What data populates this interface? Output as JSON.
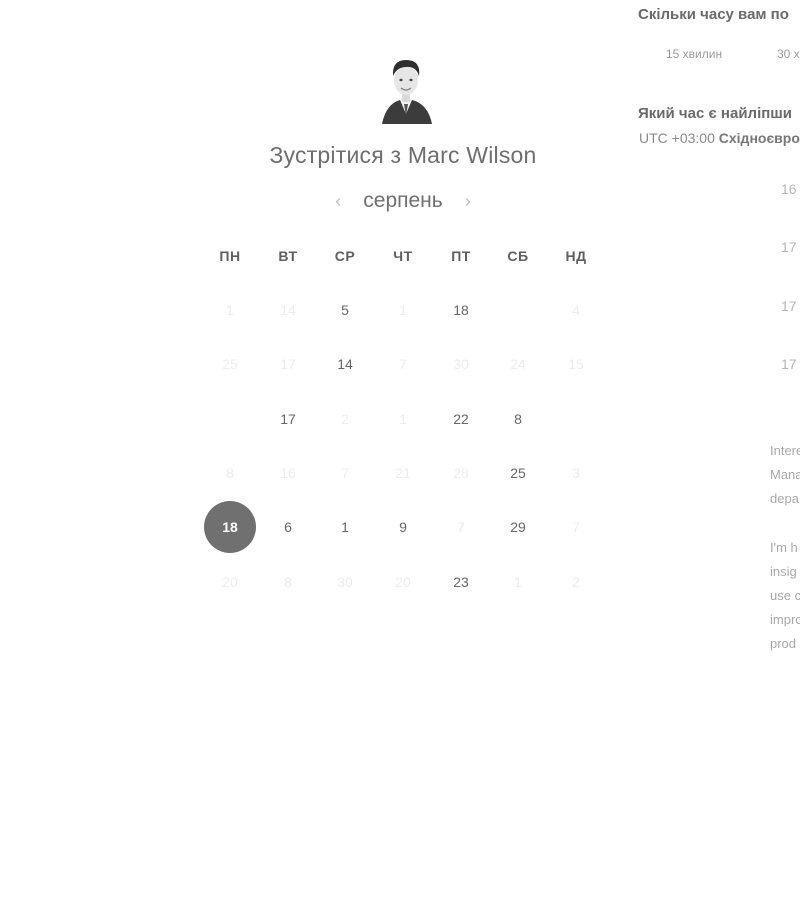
{
  "host": {
    "title_prefix": "Зустрітися з",
    "name": "Marc Wilson"
  },
  "calendar": {
    "month": "серпень",
    "weekdays": [
      "ПН",
      "ВТ",
      "СР",
      "ЧТ",
      "ПТ",
      "СБ",
      "НД"
    ],
    "rows": [
      [
        {
          "t": "1",
          "s": "dim"
        },
        {
          "t": "14",
          "s": "dim"
        },
        {
          "t": "5",
          "s": "avail"
        },
        {
          "t": "1",
          "s": "dim"
        },
        {
          "t": "18",
          "s": "avail"
        },
        {
          "t": "",
          "s": "dim"
        },
        {
          "t": "4",
          "s": "dim"
        }
      ],
      [
        {
          "t": "25",
          "s": "dim"
        },
        {
          "t": "17",
          "s": "dim"
        },
        {
          "t": "14",
          "s": "avail"
        },
        {
          "t": "7",
          "s": "dim"
        },
        {
          "t": "30",
          "s": "dim"
        },
        {
          "t": "24",
          "s": "dim"
        },
        {
          "t": "15",
          "s": "dim"
        }
      ],
      [
        {
          "t": "",
          "s": "dim"
        },
        {
          "t": "17",
          "s": "avail"
        },
        {
          "t": "2",
          "s": "dim"
        },
        {
          "t": "1",
          "s": "dim"
        },
        {
          "t": "22",
          "s": "avail"
        },
        {
          "t": "8",
          "s": "avail"
        },
        {
          "t": "",
          "s": "dim"
        }
      ],
      [
        {
          "t": "8",
          "s": "dim"
        },
        {
          "t": "16",
          "s": "dim"
        },
        {
          "t": "7",
          "s": "dim"
        },
        {
          "t": "21",
          "s": "dim"
        },
        {
          "t": "28",
          "s": "dim"
        },
        {
          "t": "25",
          "s": "avail"
        },
        {
          "t": "3",
          "s": "dim"
        }
      ],
      [
        {
          "t": "18",
          "s": "selected"
        },
        {
          "t": "6",
          "s": "avail"
        },
        {
          "t": "1",
          "s": "avail"
        },
        {
          "t": "9",
          "s": "avail"
        },
        {
          "t": "7",
          "s": "dim"
        },
        {
          "t": "29",
          "s": "avail"
        },
        {
          "t": "7",
          "s": "dim"
        }
      ],
      [
        {
          "t": "20",
          "s": "dim"
        },
        {
          "t": "8",
          "s": "dim"
        },
        {
          "t": "30",
          "s": "dim"
        },
        {
          "t": "20",
          "s": "dim"
        },
        {
          "t": "23",
          "s": "avail"
        },
        {
          "t": "1",
          "s": "dim"
        },
        {
          "t": "2",
          "s": "dim"
        }
      ]
    ]
  },
  "booking": {
    "duration_question": "Скільки часу вам по",
    "durations": [
      "15 хвилин",
      "30 х"
    ],
    "time_question": "Який час є найліпши",
    "tz_offset": "UTC +03:00",
    "tz_name": "Східноєвро",
    "slots": [
      "16",
      "17",
      "17",
      "17"
    ]
  },
  "description": {
    "para1": [
      "Intere",
      "Mana",
      "depa"
    ],
    "para2": [
      "I'm h",
      "insig",
      "use c",
      "impro",
      "prod"
    ]
  },
  "icons": {
    "prev": "chevron-left-icon",
    "next": "chevron-right-icon"
  }
}
